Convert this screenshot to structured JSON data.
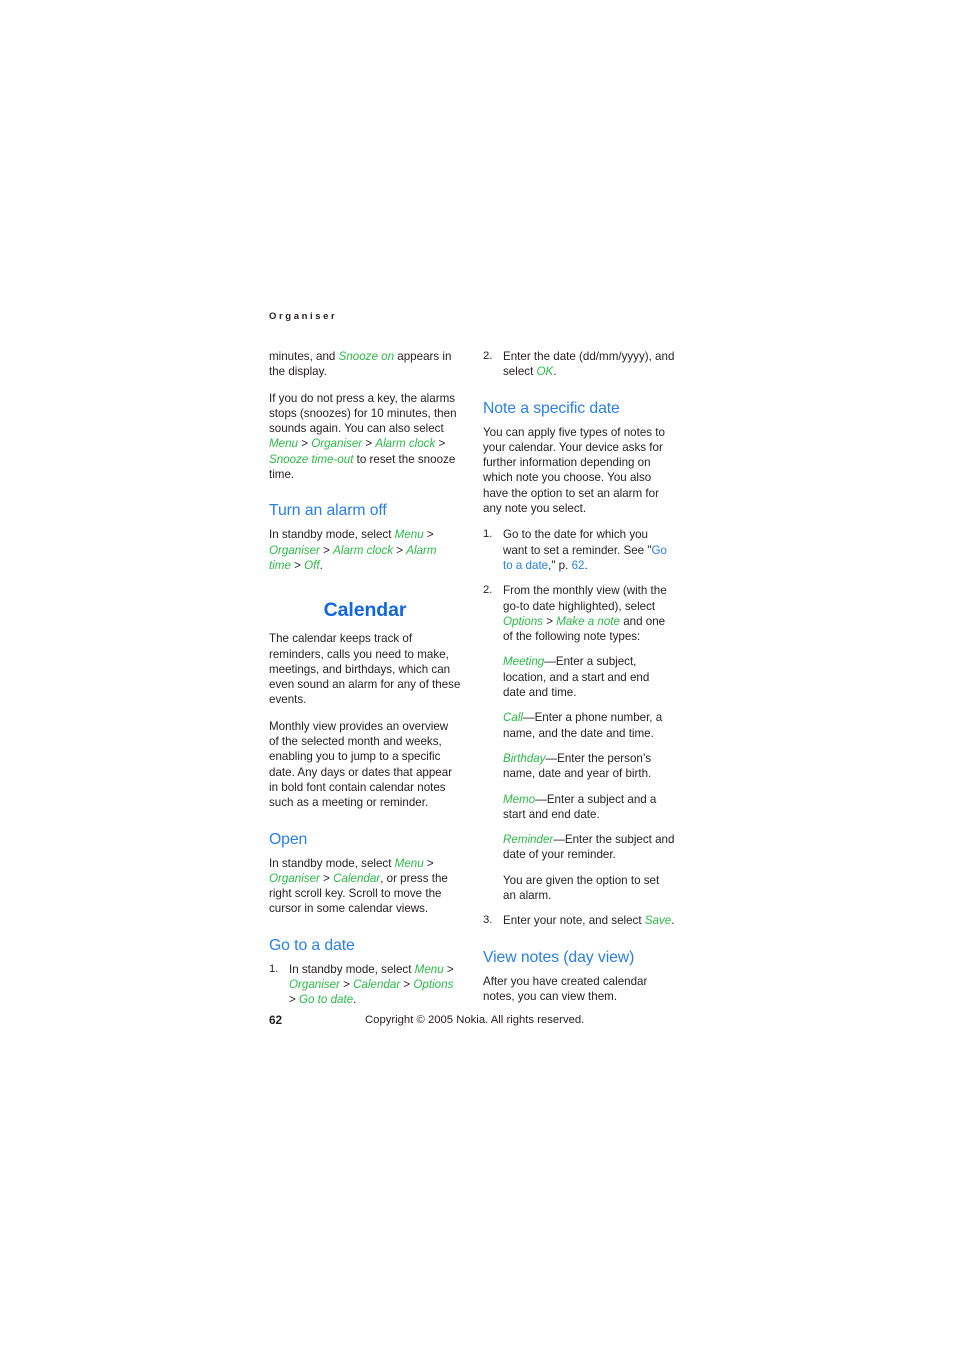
{
  "running_head": "Organiser",
  "left_column": {
    "para_1": {
      "pre": "minutes, and ",
      "cmd": "Snooze on",
      "post": " appears in the display."
    },
    "para_2": {
      "pre": "If you do not press a key, the alarms stops (snoozes) for 10 minutes, then sounds again. You can also select ",
      "cmd1": "Menu",
      "sep1": " > ",
      "cmd2": "Organiser",
      "sep2": " > ",
      "cmd3": "Alarm clock",
      "sep3": " > ",
      "cmd4": "Snooze time-out",
      "post": " to reset the snooze time."
    },
    "heading_turn_alarm_off": "Turn an alarm off",
    "para_3": {
      "pre": "In standby mode, select ",
      "cmd1": "Menu",
      "sep1": " > ",
      "cmd2": "Organiser",
      "sep2": " > ",
      "cmd3": "Alarm clock",
      "sep3": " > ",
      "cmd4": "Alarm time",
      "sep4": " > ",
      "cmd5": "Off",
      "post": "."
    },
    "chapter_title": "Calendar",
    "para_4": "The calendar keeps track of reminders, calls you need to make, meetings, and birthdays, which can even sound an alarm for any of these events.",
    "para_5": "Monthly view provides an overview of the selected month and weeks, enabling you to jump to a specific date. Any days or dates that appear in bold font contain calendar notes such as a meeting or reminder.",
    "heading_open": "Open",
    "para_6": {
      "pre": "In standby mode, select ",
      "cmd1": "Menu",
      "sep1": " > ",
      "cmd2": "Organiser",
      "sep2": " > ",
      "cmd3": "Calendar",
      "post": ", or press the right scroll key. Scroll to move the cursor in some calendar views."
    },
    "heading_go_to_date": "Go to a date",
    "step_1": {
      "num": "1.",
      "pre": "In standby mode, select ",
      "cmd1": "Menu",
      "sep1": " > ",
      "cmd2": "Organiser",
      "sep2": " > ",
      "cmd3": "Calendar",
      "sep3": " > ",
      "cmd4": "Options",
      "sep4": " > ",
      "cmd5": "Go to date",
      "post": "."
    }
  },
  "right_column": {
    "step_2_top": {
      "num": "2.",
      "pre": "Enter the date (dd/mm/yyyy), and select ",
      "cmd": "OK",
      "post": "."
    },
    "heading_note_specific_date": "Note a specific date",
    "para_1": "You can apply five types of notes to your calendar. Your device asks for further information depending on which note you choose. You also have the option to set an alarm for any note you select.",
    "step_1": {
      "num": "1.",
      "pre": "Go to the date for which you want to set a reminder. See \"",
      "xref": "Go to a date",
      "mid": ",\" p. ",
      "xref_page": "62",
      "post": "."
    },
    "step_2": {
      "num": "2.",
      "pre": "From the monthly view (with the go-to date highlighted), select ",
      "cmd1": "Options",
      "sep1": " > ",
      "cmd2": "Make a note",
      "post": " and one of the following note types:",
      "note_types": [
        {
          "term": "Meeting",
          "desc": "—Enter a subject, location, and a start and end date and time."
        },
        {
          "term": "Call",
          "desc": "—Enter a phone number, a name, and the date and time."
        },
        {
          "term": "Birthday",
          "desc": "—Enter the person’s name, date and year of birth."
        },
        {
          "term": "Memo",
          "desc": "—Enter a subject and a start and end date."
        },
        {
          "term": "Reminder",
          "desc": "—Enter the subject and date of your reminder."
        }
      ],
      "closing": "You are given the option to set an alarm."
    },
    "step_3": {
      "num": "3.",
      "pre": "Enter your note, and select ",
      "cmd": "Save",
      "post": "."
    },
    "heading_view_notes": "View notes (day view)",
    "para_2": "After you have created calendar notes, you can view them."
  },
  "footer": {
    "page_number": "62",
    "copyright": "Copyright © 2005 Nokia. All rights reserved."
  },
  "colors": {
    "heading_blue": "#2b7fe0",
    "chapter_blue": "#1166dd",
    "command_green": "#2fb84a",
    "body_text": "#231f20",
    "page_background": "#ffffff"
  }
}
